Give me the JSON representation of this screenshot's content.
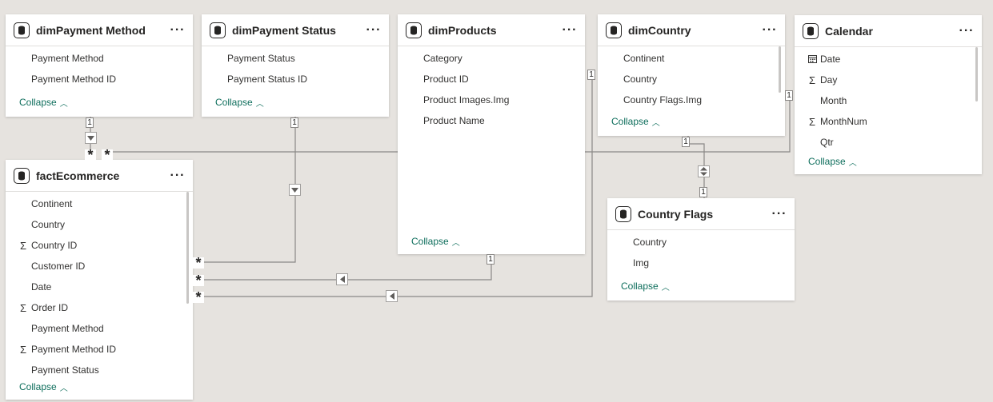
{
  "tables": {
    "payment_method": {
      "title": "dimPayment Method",
      "fields": [
        {
          "label": "Payment Method",
          "icon": ""
        },
        {
          "label": "Payment Method ID",
          "icon": ""
        }
      ],
      "collapse": "Collapse"
    },
    "payment_status": {
      "title": "dimPayment Status",
      "fields": [
        {
          "label": "Payment Status",
          "icon": ""
        },
        {
          "label": "Payment Status ID",
          "icon": ""
        }
      ],
      "collapse": "Collapse"
    },
    "products": {
      "title": "dimProducts",
      "fields": [
        {
          "label": "Category",
          "icon": ""
        },
        {
          "label": "Product ID",
          "icon": ""
        },
        {
          "label": "Product Images.Img",
          "icon": ""
        },
        {
          "label": "Product Name",
          "icon": ""
        }
      ],
      "collapse": "Collapse"
    },
    "country": {
      "title": "dimCountry",
      "fields": [
        {
          "label": "Continent",
          "icon": ""
        },
        {
          "label": "Country",
          "icon": ""
        },
        {
          "label": "Country Flags.Img",
          "icon": ""
        }
      ],
      "collapse": "Collapse"
    },
    "calendar": {
      "title": "Calendar",
      "fields": [
        {
          "label": "Date",
          "icon": "calendar-icon"
        },
        {
          "label": "Day",
          "icon": "sigma-icon"
        },
        {
          "label": "Month",
          "icon": ""
        },
        {
          "label": "MonthNum",
          "icon": "sigma-icon"
        },
        {
          "label": "Qtr",
          "icon": ""
        }
      ],
      "collapse": "Collapse"
    },
    "fact": {
      "title": "factEcommerce",
      "fields": [
        {
          "label": "Continent",
          "icon": ""
        },
        {
          "label": "Country",
          "icon": ""
        },
        {
          "label": "Country ID",
          "icon": "sigma-icon"
        },
        {
          "label": "Customer ID",
          "icon": ""
        },
        {
          "label": "Date",
          "icon": ""
        },
        {
          "label": "Order ID",
          "icon": "sigma-icon"
        },
        {
          "label": "Payment Method",
          "icon": ""
        },
        {
          "label": "Payment Method ID",
          "icon": "sigma-icon"
        },
        {
          "label": "Payment Status",
          "icon": ""
        }
      ],
      "collapse": "Collapse"
    },
    "flags": {
      "title": "Country Flags",
      "fields": [
        {
          "label": "Country",
          "icon": ""
        },
        {
          "label": "Img",
          "icon": ""
        }
      ],
      "collapse": "Collapse"
    }
  },
  "cardinality": {
    "one": "1",
    "many": "*"
  },
  "more_label": "···",
  "colors": {
    "canvas": "#e6e3df",
    "line": "#8a8886",
    "collapse_link": "#0e6e5c"
  }
}
